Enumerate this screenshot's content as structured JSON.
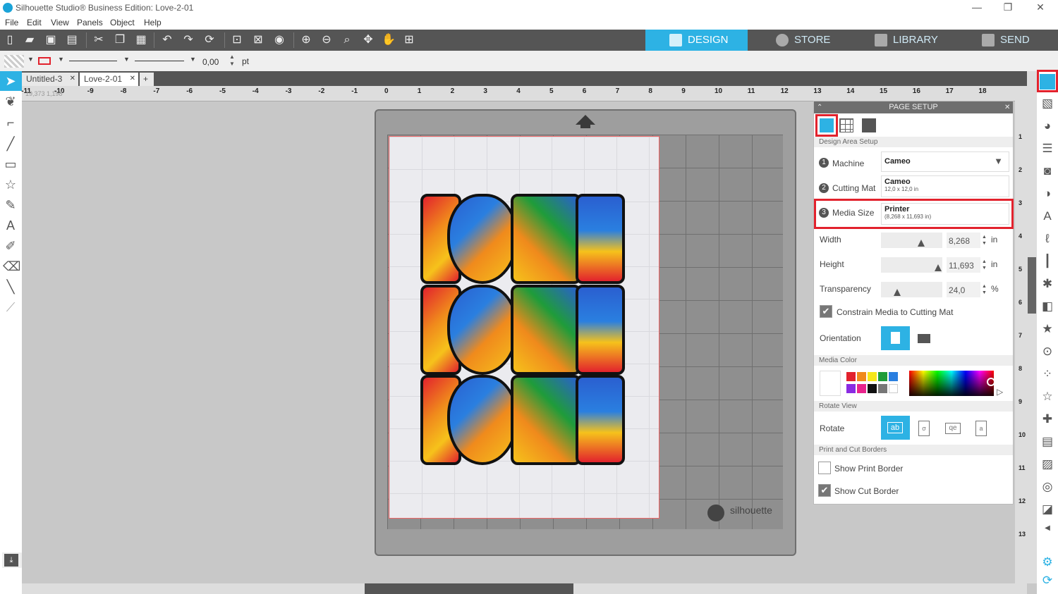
{
  "window": {
    "title": "Silhouette Studio® Business Edition: Love-2-01",
    "controls": [
      "—",
      "❐",
      "✕"
    ]
  },
  "menu": [
    "File",
    "Edit",
    "View",
    "Panels",
    "Object",
    "Help"
  ],
  "nav_tabs": {
    "design": "DESIGN",
    "store": "STORE",
    "library": "LIBRARY",
    "send": "SEND"
  },
  "line_bar": {
    "line_width": "0,00",
    "unit": "pt"
  },
  "doc_tabs": [
    {
      "label": "Untitled-3"
    },
    {
      "label": "Love-2-01"
    }
  ],
  "doc_tab_close": "✕",
  "doc_tab_add": "+",
  "ruler": {
    "h_labels": [
      "-11",
      "-10",
      "-9",
      "-8",
      "-7",
      "-6",
      "-5",
      "-4",
      "-3",
      "-2",
      "-1",
      "0",
      "1",
      "2",
      "3",
      "4",
      "5",
      "6",
      "7",
      "8",
      "9",
      "10",
      "11",
      "12",
      "13",
      "14",
      "15",
      "16",
      "17",
      "18"
    ],
    "v_labels": [
      "1",
      "2",
      "3",
      "4",
      "5",
      "6",
      "7",
      "8",
      "9",
      "10",
      "11",
      "12",
      "13"
    ],
    "coords": "19,373  1,198"
  },
  "mat": {
    "brand": "silhouette"
  },
  "artwork": {
    "word": "LOVE",
    "repeat": 3
  },
  "page_setup": {
    "title": "PAGE SETUP",
    "close": "✕",
    "section_design_area": "Design Area Setup",
    "machine_label": "Machine",
    "machine_value": "Cameo",
    "cutting_mat_label": "Cutting Mat",
    "cutting_mat_value": "Cameo",
    "cutting_mat_size": "12,0 x 12,0 in",
    "media_size_label": "Media Size",
    "media_size_value": "Printer",
    "media_size_detail": "(8,268 x 11,693 in)",
    "step_numbers": [
      "1",
      "2",
      "3"
    ],
    "width_label": "Width",
    "width_value": "8,268",
    "width_unit": "in",
    "height_label": "Height",
    "height_value": "11,693",
    "height_unit": "in",
    "transparency_label": "Transparency",
    "transparency_value": "24,0",
    "transparency_unit": "%",
    "constrain_label": "Constrain Media to Cutting Mat",
    "orientation_label": "Orientation",
    "section_media_color": "Media Color",
    "section_rotate_view": "Rotate View",
    "rotate_label": "Rotate",
    "section_borders": "Print and Cut Borders",
    "show_print_border": "Show Print Border",
    "show_cut_border": "Show Cut Border"
  },
  "swatch_colors": [
    "#e2222d",
    "#f08a1c",
    "#f6e71b",
    "#1f9c3a",
    "#2a7fe0",
    "#8a2be2",
    "#e8248c",
    "#111111",
    "#777777",
    "#ffffff"
  ]
}
